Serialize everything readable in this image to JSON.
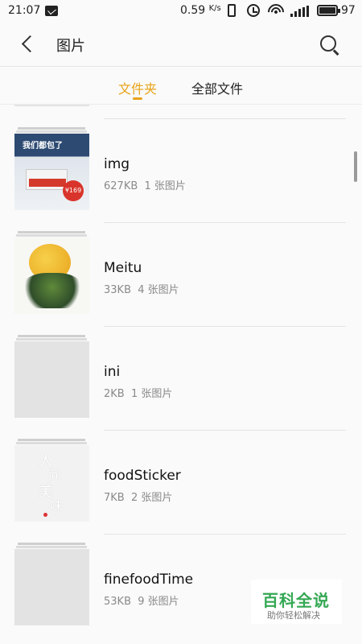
{
  "status_bar": {
    "time": "21:07",
    "network_speed": "0.59",
    "network_unit": "K/s",
    "battery": "97"
  },
  "header": {
    "title": "图片"
  },
  "tabs": [
    {
      "label": "文件夹",
      "active": true
    },
    {
      "label": "全部文件",
      "active": false
    }
  ],
  "folders": [
    {
      "name": "img",
      "size": "627KB",
      "count": "1 张图片"
    },
    {
      "name": "Meitu",
      "size": "33KB",
      "count": "4 张图片"
    },
    {
      "name": "ini",
      "size": "2KB",
      "count": "1 张图片"
    },
    {
      "name": "foodSticker",
      "size": "7KB",
      "count": "2 张图片"
    },
    {
      "name": "finefoodTime",
      "size": "53KB",
      "count": "9 张图片"
    }
  ],
  "thumb_text": {
    "img_headline": "我们都包了",
    "img_price": "¥169",
    "food_poem_1": "人",
    "food_poem_2": "间",
    "food_poem_3": "美",
    "food_poem_4": "味"
  },
  "watermark": {
    "main": "百科全说",
    "sub": "助你轻松解决"
  },
  "colors": {
    "accent": "#e8a319",
    "watermark_green": "#34a853"
  }
}
